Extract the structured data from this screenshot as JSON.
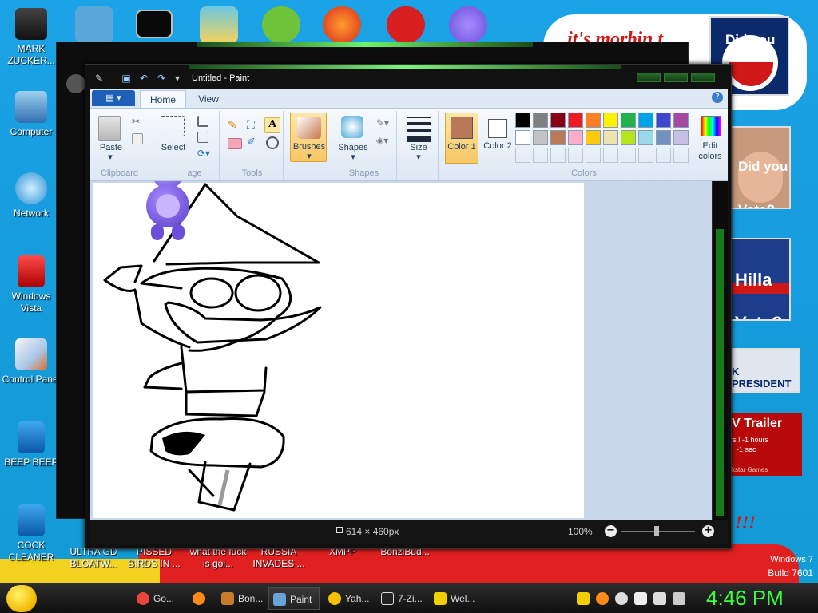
{
  "desktop_icons": [
    {
      "label": "MARK ZUCKER...",
      "icon": "person-photo-icon"
    },
    {
      "label": "Computer",
      "icon": "computer-icon"
    },
    {
      "label": "Network",
      "icon": "network-globe-icon"
    },
    {
      "label": "Windows Vista",
      "icon": "recycle-bin-icon"
    },
    {
      "label": "Control Panel",
      "icon": "control-panel-icon"
    },
    {
      "label": "BEEP BEEP",
      "icon": "blue-file-icon"
    },
    {
      "label": "COCK CLEANER",
      "icon": "blue-file-icon"
    }
  ],
  "bottom_desktop_labels": [
    "ULTRA GD BLOATW...",
    "PISSED BIRDS IN ...",
    "what the fuck is goi...",
    "RUSSIA INVADES ...",
    "XMPP",
    "BonziBud..."
  ],
  "top_icons": [
    "notes-icon",
    "cmd-icon",
    "folder-stack-icon",
    "angry-bird-icon",
    "p-logo-icon",
    "devcpp-icon",
    "bonzi-icon"
  ],
  "wallpaper": {
    "cloud_text": "it's morbin t",
    "poster1_text": "Did you",
    "poster2_text": "Did you Vote?",
    "poster3_text": "Hilla Vote?",
    "president_text": "K PRESIDENT",
    "trailer_title": "V Trailer",
    "trailer_line1": "rs ! -1 hours",
    "trailer_line2": "-1 sec",
    "trailer_brand": "kstar Games",
    "bangs": "!!!"
  },
  "paint": {
    "title": "Untitled - Paint",
    "tabs": [
      "Home",
      "View"
    ],
    "groups": {
      "clipboard": {
        "label": "Clipboard",
        "paste": "Paste"
      },
      "image": {
        "label": "age",
        "select": "Select"
      },
      "tools": {
        "label": "Tools"
      },
      "brushes": {
        "label": "Brushes"
      },
      "shapes": {
        "label": "Shapes",
        "button": "Shapes"
      },
      "size": {
        "label": "Size"
      },
      "colors": {
        "label": "Colors",
        "color1": "Color 1",
        "color2": "Color 2",
        "edit": "Edit colors"
      }
    },
    "color1_value": "#b9785a",
    "color2_value": "#ffffff",
    "palette_row1": [
      "#000000",
      "#7f7f7f",
      "#880015",
      "#ed1c24",
      "#ff7f27",
      "#fff200",
      "#22b14c",
      "#00a2e8",
      "#3f48cc",
      "#a349a4"
    ],
    "palette_row2": [
      "#ffffff",
      "#c3c3c3",
      "#b97a57",
      "#ffaec9",
      "#ffc90e",
      "#efe4b0",
      "#b5e61d",
      "#99d9ea",
      "#7092be",
      "#c8bfe7"
    ],
    "status": {
      "dimensions": "614 × 460px",
      "zoom": "100%"
    }
  },
  "taskbar": {
    "items": [
      {
        "label": "Go...",
        "icon": "chrome-icon",
        "color": "#e8453c"
      },
      {
        "label": "",
        "icon": "firefox-icon",
        "color": "#ff8a1a"
      },
      {
        "label": "Bon...",
        "icon": "book-icon",
        "color": "#c97b2d"
      },
      {
        "label": "Paint",
        "icon": "paint-icon",
        "color": "#6aa3d8"
      },
      {
        "label": "Yah...",
        "icon": "smiley-icon",
        "color": "#f2c200"
      },
      {
        "label": "7-Zi...",
        "icon": "7zip-icon",
        "color": "#dddddd"
      },
      {
        "label": "Wel...",
        "icon": "welcome-icon",
        "color": "#f0d000"
      }
    ],
    "clock": "4:46 PM",
    "windows_version": "Windows 7",
    "build": "Build 7601"
  }
}
